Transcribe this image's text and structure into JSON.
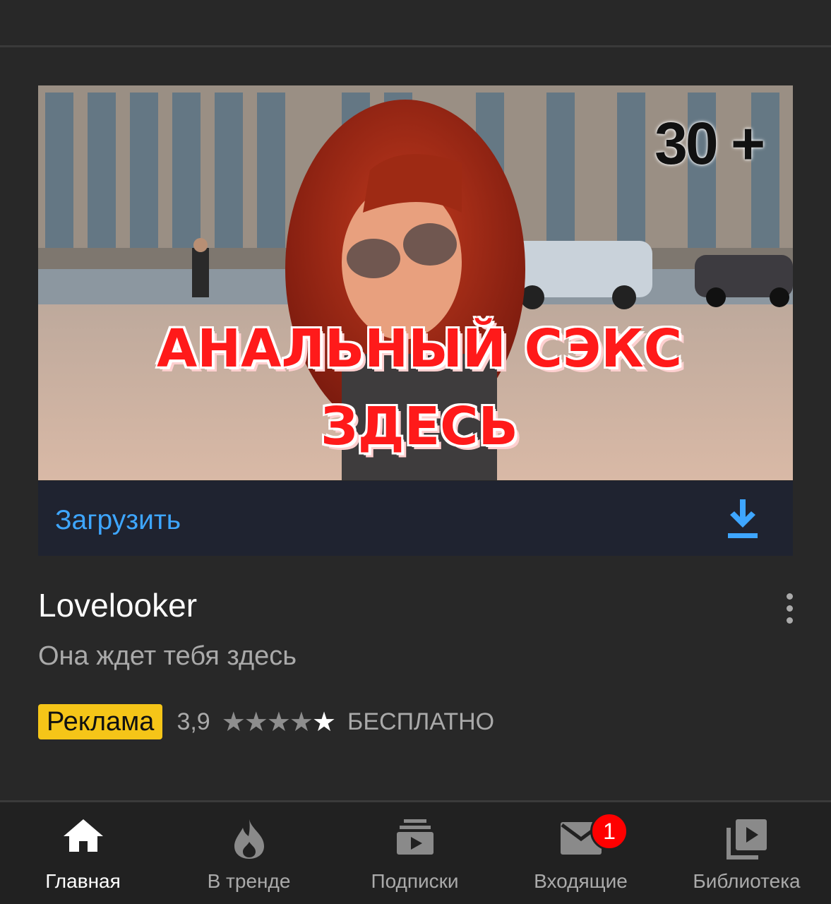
{
  "ad": {
    "age_label": "30 +",
    "headline_line1": "АНАЛЬНЫЙ СЭКС",
    "headline_line2": "ЗДЕСЬ",
    "download_label": "Загрузить",
    "channel_name": "Lovelooker",
    "subtitle": "Она ждет тебя здесь",
    "badge": "Реклама",
    "rating": "3,9",
    "rating_stars": 3.9,
    "stars_filled": "★★★★",
    "stars_empty": "★",
    "price": "БЕСПЛАТНО"
  },
  "bottom_nav": {
    "items": [
      {
        "label": "Главная",
        "icon": "home-icon",
        "active": true
      },
      {
        "label": "В тренде",
        "icon": "flame-icon"
      },
      {
        "label": "Подписки",
        "icon": "subscriptions-icon"
      },
      {
        "label": "Входящие",
        "icon": "mail-icon",
        "badge": "1"
      },
      {
        "label": "Библиотека",
        "icon": "library-icon"
      }
    ]
  },
  "colors": {
    "background": "#282828",
    "accent_blue": "#3ea6ff",
    "ad_badge": "#f5c518",
    "notification_red": "#ff0000"
  }
}
